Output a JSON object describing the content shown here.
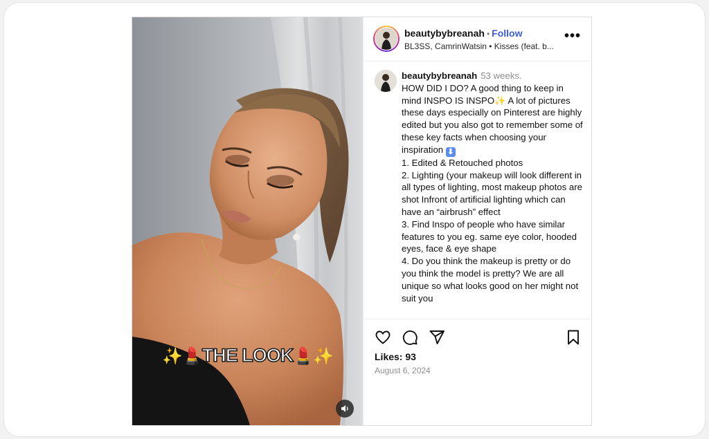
{
  "post": {
    "username": "beautybybreanah",
    "follow_label": "Follow",
    "header_separator": "•",
    "subtitle": "BL3SS, CamrinWatsin • Kisses (feat. b...",
    "more_label": "•••",
    "overlay": {
      "sparkle_left": "✨",
      "lipstick_left": "💄",
      "text": "THE LOOK",
      "lipstick_right": "💄",
      "sparkle_right": "✨"
    },
    "caption": {
      "username": "beautybybreanah",
      "age": "53 weeks.",
      "intro": "HOW DID I DO? A good thing to keep in mind INSPO IS INSPO",
      "sparkle": "✨",
      "intro_rest": " A lot of pictures these days especially on Pinterest are highly edited but you also got to remember some of these key facts when choosing your inspiration",
      "down_arrow": "⬇",
      "lines": [
        "1. Edited & Retouched photos",
        "2. Lighting (your makeup will look different in all types of lighting, most makeup photos are shot Infront of artificial lighting which can have an “airbrush” effect",
        "3. Find Inspo of people who have similar features to you eg. same eye color, hooded eyes, face & eye shape",
        "4. Do you think the makeup is pretty or do you think the model is pretty? We are all unique so what looks good on her might not suit you"
      ]
    },
    "likes_label": "Likes: 93",
    "date": "August 6, 2024"
  },
  "colors": {
    "follow": "#3b5bdb",
    "muted": "#8e8e8e",
    "border": "#dbdbdb"
  },
  "icons": [
    "heart-icon",
    "comment-icon",
    "share-icon",
    "bookmark-icon",
    "speaker-icon",
    "more-icon"
  ]
}
